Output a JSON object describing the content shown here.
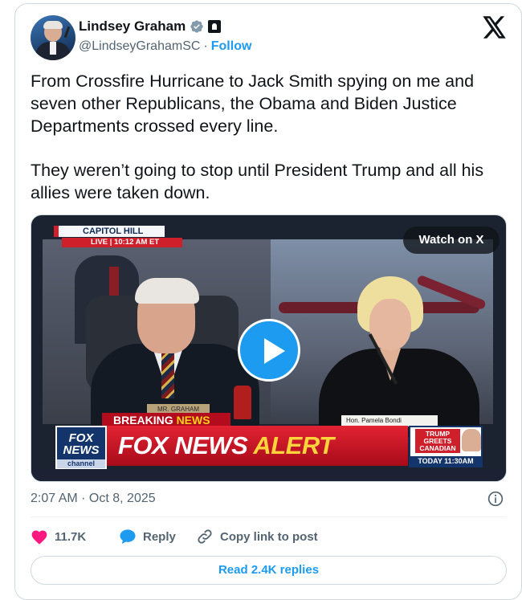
{
  "author": {
    "name": "Lindsey Graham",
    "handle": "@LindseyGrahamSC",
    "separator": "·",
    "follow_label": "Follow"
  },
  "icons": {
    "verified": "verified-badge-icon",
    "government": "government-affiliation-icon",
    "platform": "x-logo-icon",
    "info": "info-icon",
    "like": "heart-icon",
    "reply": "speech-bubble-icon",
    "copy_link": "link-icon",
    "play": "play-icon"
  },
  "colors": {
    "accent": "#1d9bf0",
    "like": "#f91880",
    "muted_text": "#536471",
    "fox_red": "#cf1f2b",
    "fox_blue": "#14356b"
  },
  "tweet": {
    "paragraph_1": "From Crossfire Hurricane to Jack Smith spying on me and seven other Republicans, the Obama and Biden Justice Departments crossed every line.",
    "paragraph_2": "They weren’t going to stop until President Trump and all his allies were taken down."
  },
  "media": {
    "watch_label": "Watch on X",
    "location_bug": "CAPITOL HILL",
    "live_bug": "LIVE | 10:12 AM ET",
    "nameplate_left": "MR. GRAHAM",
    "nameplate_right": "Hon. Pamela Bondi",
    "breaking_prefix": "BREAKING ",
    "breaking_suffix": "NEWS",
    "network_logo_line1": "FOX",
    "network_logo_line2": "NEWS",
    "network_logo_line3": "channel",
    "alert_prefix": "FOX NEWS ",
    "alert_suffix": "ALERT",
    "promo_headline": "TRUMP GREETS CANADIAN PM CARNEY",
    "promo_time": "TODAY 11:30AM"
  },
  "timestamp": "2:07 AM · Oct 8, 2025",
  "actions": {
    "like_count": "11.7K",
    "reply_label": "Reply",
    "copy_link_label": "Copy link to post"
  },
  "read_replies_label": "Read 2.4K replies"
}
